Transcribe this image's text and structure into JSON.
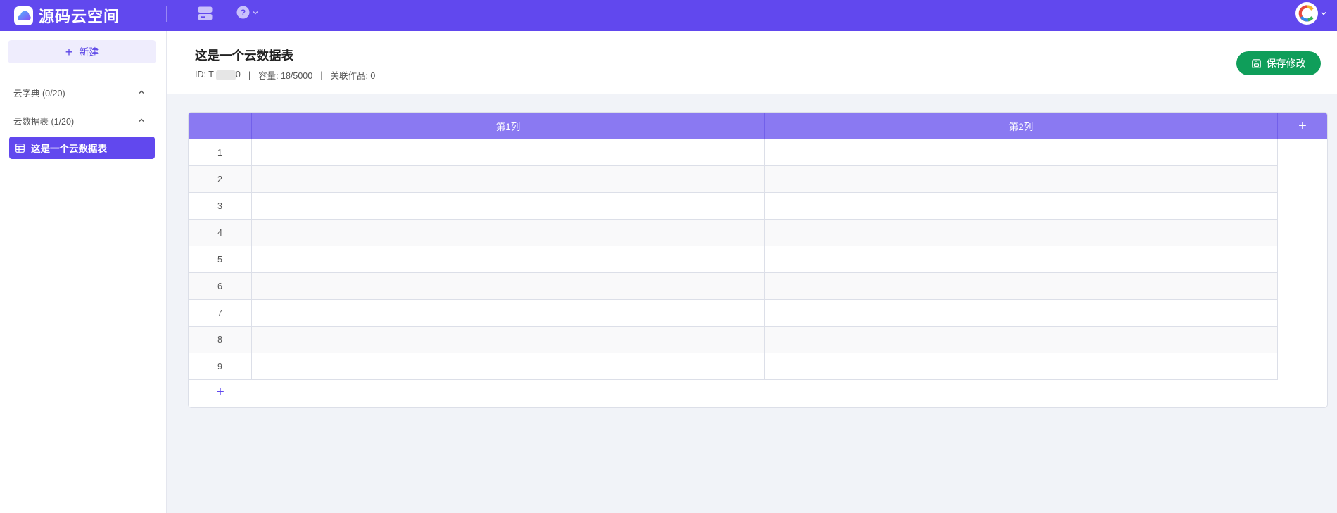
{
  "app": {
    "name": "源码云空间"
  },
  "colors": {
    "accent": "#6148ee",
    "table_header": "#8a79f2",
    "save_button": "#0f9e5a"
  },
  "toolbar": {
    "server_icon": "server-icon",
    "help_icon": "help-icon"
  },
  "sidebar": {
    "new_label": "新建",
    "groups": [
      {
        "label": "云字典 (0/20)"
      },
      {
        "label": "云数据表 (1/20)"
      }
    ],
    "items": [
      {
        "label": "这是一个云数据表",
        "selected": true
      }
    ]
  },
  "header": {
    "title": "这是一个云数据表",
    "id_label": "ID: T",
    "id_suffix": "0",
    "capacity": "容量: 18/5000",
    "linked": "关联作品: 0",
    "separator": "|",
    "save_label": "保存修改"
  },
  "table": {
    "columns": [
      "第1列",
      "第2列"
    ],
    "add_column": "+",
    "add_row": "+",
    "rows": [
      {
        "index": "1",
        "cells": [
          "",
          ""
        ]
      },
      {
        "index": "2",
        "cells": [
          "",
          ""
        ]
      },
      {
        "index": "3",
        "cells": [
          "",
          ""
        ]
      },
      {
        "index": "4",
        "cells": [
          "",
          ""
        ]
      },
      {
        "index": "5",
        "cells": [
          "",
          ""
        ]
      },
      {
        "index": "6",
        "cells": [
          "",
          ""
        ]
      },
      {
        "index": "7",
        "cells": [
          "",
          ""
        ]
      },
      {
        "index": "8",
        "cells": [
          "",
          ""
        ]
      },
      {
        "index": "9",
        "cells": [
          "",
          ""
        ]
      }
    ]
  }
}
